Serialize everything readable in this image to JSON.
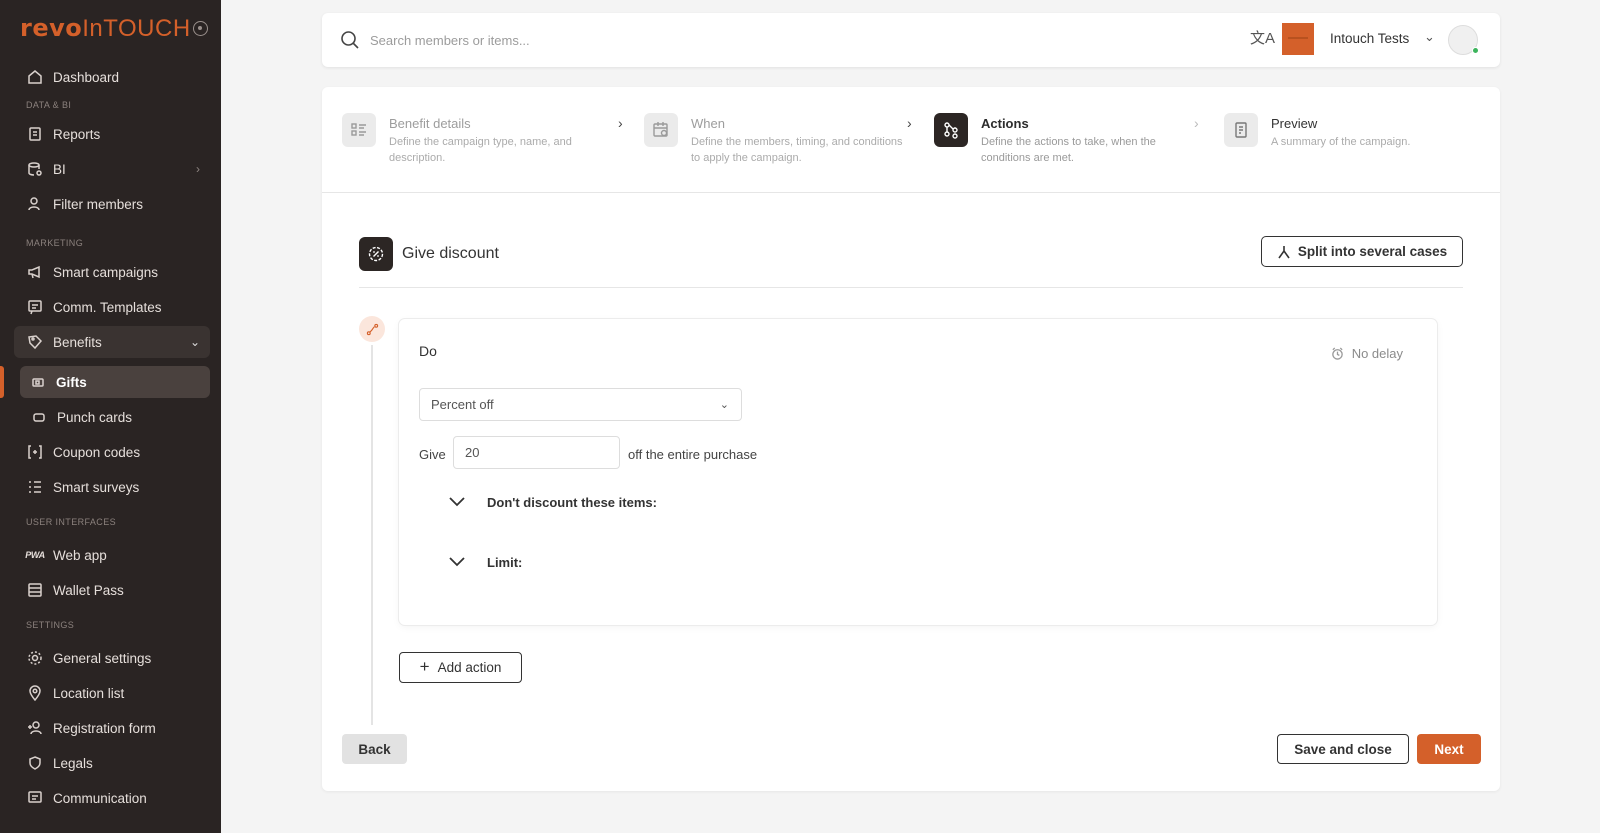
{
  "brand": {
    "logo_bold": "revo",
    "logo_light": "InTOUCH",
    "accent": "#d4602a"
  },
  "sidebar": {
    "dashboard": "Dashboard",
    "section_data": "DATA & BI",
    "reports": "Reports",
    "bi": "BI",
    "filter_members": "Filter members",
    "section_marketing": "MARKETING",
    "smart_campaigns": "Smart campaigns",
    "comm_templates": "Comm. Templates",
    "benefits": "Benefits",
    "gifts": "Gifts",
    "punch_cards": "Punch cards",
    "coupon_codes": "Coupon codes",
    "smart_surveys": "Smart surveys",
    "section_ui": "USER INTERFACES",
    "pwa_badge": "PWA",
    "web_app": "Web app",
    "wallet_pass": "Wallet Pass",
    "section_settings": "SETTINGS",
    "general_settings": "General settings",
    "location_list": "Location list",
    "registration_form": "Registration form",
    "legals": "Legals",
    "communication": "Communication"
  },
  "topbar": {
    "search_placeholder": "Search members or items...",
    "org_name": "Intouch Tests"
  },
  "stepper": [
    {
      "title": "Benefit details",
      "desc": "Define the campaign type, name, and description."
    },
    {
      "title": "When",
      "desc": "Define the members, timing, and conditions to apply the campaign."
    },
    {
      "title": "Actions",
      "desc": "Define the actions to take, when the conditions are met."
    },
    {
      "title": "Preview",
      "desc": "A summary of the campaign."
    }
  ],
  "action": {
    "title": "Give discount",
    "split_label": "Split into several cases",
    "do_label": "Do",
    "delay_label": "No delay",
    "discount_type": "Percent off",
    "give_label": "Give",
    "give_value": "20",
    "give_suffix": "off the entire purchase",
    "exclude_label": "Don't discount these items:",
    "limit_label": "Limit:",
    "add_action_label": "Add action"
  },
  "footer": {
    "back": "Back",
    "save_close": "Save and close",
    "next": "Next"
  }
}
